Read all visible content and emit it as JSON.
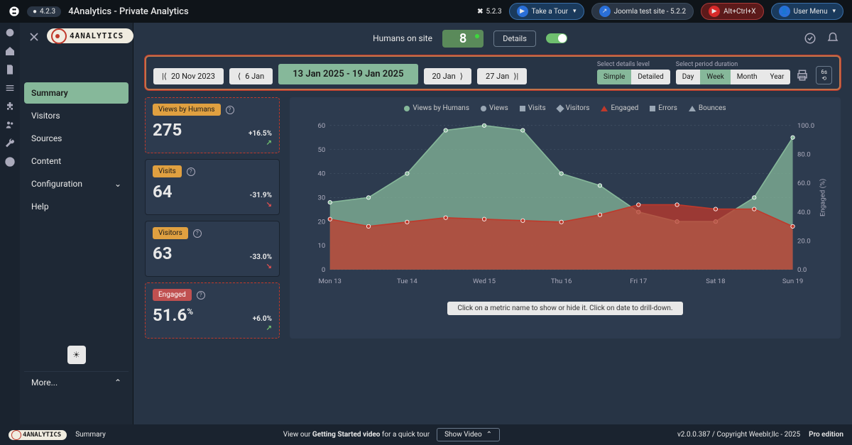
{
  "topbar": {
    "app_version": "4.2.3",
    "title": "4Analytics - Private Analytics",
    "joomla_version": "5.2.3",
    "tour": "Take a Tour",
    "site": "Joomla test site - 5.2.2",
    "shortcut": "Alt+Ctrl+X",
    "usermenu": "User Menu"
  },
  "sidebar": {
    "logo": "4ANALYTICS",
    "items": [
      "Summary",
      "Visitors",
      "Sources",
      "Content",
      "Configuration",
      "Help"
    ],
    "more": "More..."
  },
  "header": {
    "humans_label": "Humans on site",
    "humans_count": "8",
    "details": "Details"
  },
  "filters": {
    "first": "20 Nov 2023",
    "prev": "6 Jan",
    "range": "13 Jan 2025 - 19 Jan 2025",
    "next": "20 Jan",
    "last": "27 Jan",
    "details_label": "Select details level",
    "details_opts": [
      "Simple",
      "Detailed"
    ],
    "period_label": "Select period duration",
    "period_opts": [
      "Day",
      "Week",
      "Month",
      "Year"
    ],
    "refresh": "6s"
  },
  "cards": [
    {
      "label": "Views by Humans",
      "value": "275",
      "delta": "+16.5%",
      "dir": "up",
      "tag": "orange",
      "hl": true
    },
    {
      "label": "Visits",
      "value": "64",
      "delta": "-31.9%",
      "dir": "dn",
      "tag": "orange",
      "hl": false
    },
    {
      "label": "Visitors",
      "value": "63",
      "delta": "-33.0%",
      "dir": "dn",
      "tag": "orange",
      "hl": false
    },
    {
      "label": "Engaged",
      "value": "51.6",
      "suffix": "%",
      "delta": "+6.0%",
      "dir": "up",
      "tag": "red",
      "hl": true
    }
  ],
  "legend": [
    {
      "name": "Views by Humans",
      "color": "#86b89a",
      "shape": "dot"
    },
    {
      "name": "Views",
      "color": "#9aa7b5",
      "shape": "dot"
    },
    {
      "name": "Visits",
      "color": "#9aa7b5",
      "shape": "sq"
    },
    {
      "name": "Visitors",
      "color": "#9aa7b5",
      "shape": "diamond"
    },
    {
      "name": "Engaged",
      "color": "#c0392b",
      "shape": "tri"
    },
    {
      "name": "Errors",
      "color": "#9aa7b5",
      "shape": "sq"
    },
    {
      "name": "Bounces",
      "color": "#9aa7b5",
      "shape": "tri"
    }
  ],
  "chart_data": {
    "type": "area",
    "x_labels": [
      "Mon 13",
      "Tue 14",
      "Wed 15",
      "Thu 16",
      "Fri 17",
      "Sat 18",
      "Sun 19"
    ],
    "y_left": {
      "label": "",
      "ticks": [
        0,
        10,
        20,
        30,
        40,
        50,
        60
      ]
    },
    "y_right": {
      "label": "Engaged (%)",
      "ticks": [
        0,
        20.0,
        40.0,
        60.0,
        80.0,
        100.0
      ]
    },
    "series": [
      {
        "name": "Views by Humans",
        "color": "#86b89a",
        "axis": "left",
        "values": [
          28,
          30,
          40,
          58,
          60,
          58,
          40,
          35,
          24,
          20,
          20,
          30,
          55
        ]
      },
      {
        "name": "Engaged",
        "color": "#c0392b",
        "axis": "right",
        "values": [
          35,
          30,
          33,
          36,
          35,
          34,
          33,
          38,
          45,
          45,
          42,
          42,
          30
        ]
      }
    ],
    "tip": "Click on a metric name to show or hide it. Click on date to drill-down."
  },
  "footer": {
    "logo": "4ANALYTICS",
    "crumb": "Summary",
    "video_pre": "View our ",
    "video_bold": "Getting Started video",
    "video_post": " for a quick tour",
    "video_btn": "Show Video",
    "version": "v2.0.0.387  /  Copyright Weeblr,llc - 2025",
    "edition": "Pro edition"
  }
}
